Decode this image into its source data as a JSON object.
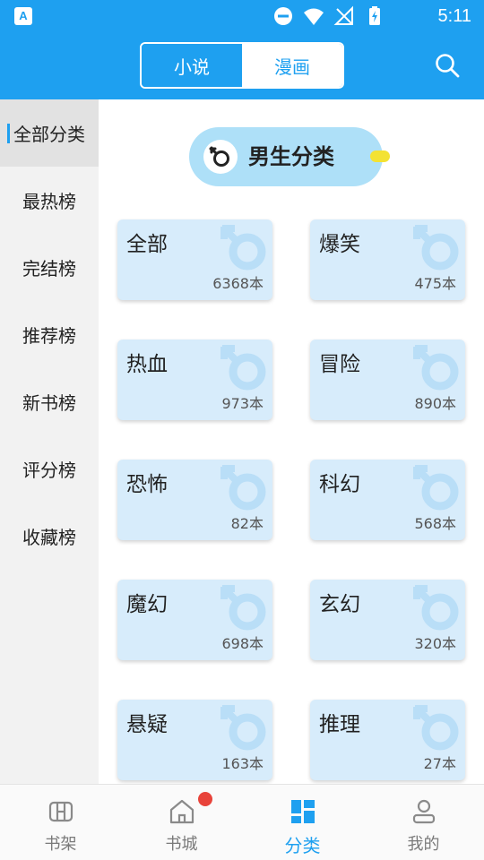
{
  "status_bar": {
    "time": "5:11",
    "app_icon_letter": "A"
  },
  "header": {
    "tabs": [
      {
        "label": "小说",
        "selected": false
      },
      {
        "label": "漫画",
        "selected": true
      }
    ],
    "search_icon": "search-icon"
  },
  "sidebar": {
    "items": [
      {
        "label": "全部分类",
        "active": true
      },
      {
        "label": "最热榜"
      },
      {
        "label": "完结榜"
      },
      {
        "label": "推荐榜"
      },
      {
        "label": "新书榜"
      },
      {
        "label": "评分榜"
      },
      {
        "label": "收藏榜"
      }
    ]
  },
  "section": {
    "title": "男生分类",
    "icon": "male-symbol-icon"
  },
  "categories": [
    {
      "name": "全部",
      "count": "6368本"
    },
    {
      "name": "爆笑",
      "count": "475本"
    },
    {
      "name": "热血",
      "count": "973本"
    },
    {
      "name": "冒险",
      "count": "890本"
    },
    {
      "name": "恐怖",
      "count": "82本"
    },
    {
      "name": "科幻",
      "count": "568本"
    },
    {
      "name": "魔幻",
      "count": "698本"
    },
    {
      "name": "玄幻",
      "count": "320本"
    },
    {
      "name": "悬疑",
      "count": "163本"
    },
    {
      "name": "推理",
      "count": "27本"
    }
  ],
  "bottom_nav": {
    "items": [
      {
        "label": "书架",
        "icon": "bookshelf-icon"
      },
      {
        "label": "书城",
        "icon": "home-icon"
      },
      {
        "label": "分类",
        "icon": "category-grid-icon",
        "active": true
      },
      {
        "label": "我的",
        "icon": "profile-icon"
      }
    ]
  },
  "colors": {
    "accent": "#1ea0f0",
    "card_bg": "#d7ecfb",
    "pill_bg": "#aee0f8",
    "badge": "#e8433a"
  }
}
